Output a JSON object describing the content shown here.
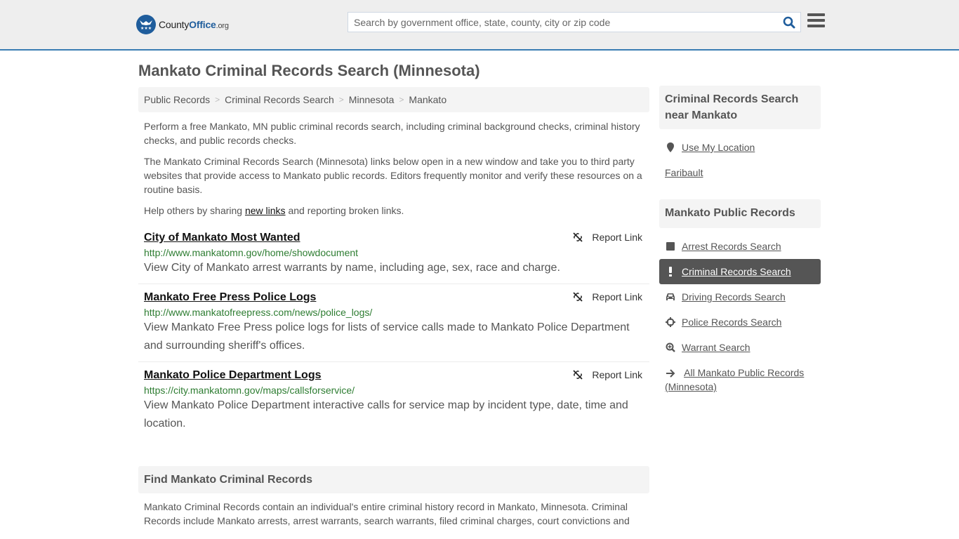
{
  "header": {
    "logo": {
      "name_prefix": "County",
      "name_bold": "Office",
      "name_suffix": ".org"
    },
    "search": {
      "placeholder": "Search by government office, state, county, city or zip code",
      "value": ""
    },
    "colors": {
      "brand": "#1f5d9c",
      "header_border": "#3a7db3"
    }
  },
  "page": {
    "title": "Mankato Criminal Records Search (Minnesota)"
  },
  "breadcrumb": [
    {
      "label": "Public Records"
    },
    {
      "label": "Criminal Records Search"
    },
    {
      "label": "Minnesota"
    },
    {
      "label": "Mankato"
    }
  ],
  "intro": {
    "p1": "Perform a free Mankato, MN public criminal records search, including criminal background checks, criminal history checks, and public records checks.",
    "p2": "The Mankato Criminal Records Search (Minnesota) links below open in a new window and take you to third party websites that provide access to Mankato public records. Editors frequently monitor and verify these resources on a routine basis.",
    "p3_before": "Help others by sharing ",
    "p3_link": "new links",
    "p3_after": " and reporting broken links."
  },
  "results": [
    {
      "title": "City of Mankato Most Wanted",
      "url": "http://www.mankatomn.gov/home/showdocument",
      "description": "View City of Mankato arrest warrants by name, including age, sex, race and charge.",
      "report_label": "Report Link"
    },
    {
      "title": "Mankato Free Press Police Logs",
      "url": "http://www.mankatofreepress.com/news/police_logs/",
      "description": "View Mankato Free Press police logs for lists of service calls made to Mankato Police Department and surrounding sheriff's offices.",
      "report_label": "Report Link"
    },
    {
      "title": "Mankato Police Department Logs",
      "url": "https://city.mankatomn.gov/maps/callsforservice/",
      "description": "View Mankato Police Department interactive calls for service map by incident type, date, time and location.",
      "report_label": "Report Link"
    }
  ],
  "find_section": {
    "heading": "Find Mankato Criminal Records",
    "text": "Mankato Criminal Records contain an individual's entire criminal history record in Mankato, Minnesota. Criminal Records include Mankato arrests, arrest warrants, search warrants, filed criminal charges, court convictions and"
  },
  "sidebar": {
    "nearby": {
      "heading": "Criminal Records Search near Mankato",
      "use_location": "Use My Location",
      "places": [
        "Faribault"
      ]
    },
    "public_records": {
      "heading": "Mankato Public Records",
      "items": [
        {
          "label": "Arrest Records Search",
          "icon": "square-icon",
          "active": false
        },
        {
          "label": "Criminal Records Search",
          "icon": "exclamation-icon",
          "active": true
        },
        {
          "label": "Driving Records Search",
          "icon": "car-icon",
          "active": false
        },
        {
          "label": "Police Records Search",
          "icon": "crosshairs-icon",
          "active": false
        },
        {
          "label": "Warrant Search",
          "icon": "search-plus-icon",
          "active": false
        },
        {
          "label": "All Mankato Public Records (Minnesota)",
          "icon": "arrow-right-icon",
          "active": false
        }
      ]
    }
  }
}
